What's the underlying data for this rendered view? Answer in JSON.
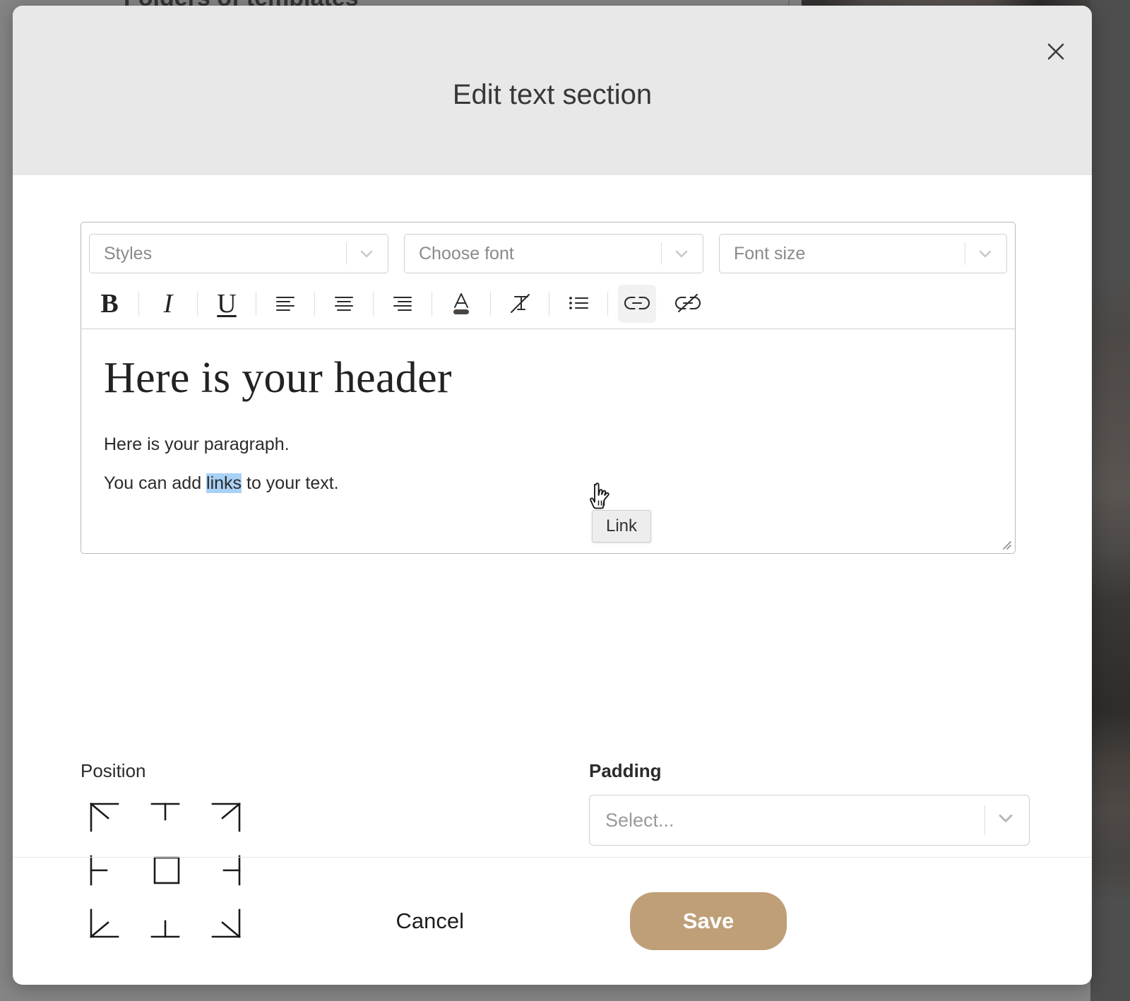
{
  "background": {
    "page_title": "Folders of templates"
  },
  "modal": {
    "title": "Edit text section",
    "close_icon": "close-icon"
  },
  "editor": {
    "selects": [
      {
        "name": "styles",
        "placeholder": "Styles"
      },
      {
        "name": "font",
        "placeholder": "Choose font"
      },
      {
        "name": "font-size",
        "placeholder": "Font size"
      }
    ],
    "toolbar_buttons": [
      {
        "name": "bold",
        "icon": "bold-icon",
        "label": "B",
        "active": false
      },
      {
        "name": "italic",
        "icon": "italic-icon",
        "label": "I",
        "active": false
      },
      {
        "name": "underline",
        "icon": "underline-icon",
        "label": "U",
        "active": false
      },
      {
        "name": "align-left",
        "icon": "align-left-icon",
        "label": "",
        "active": false
      },
      {
        "name": "align-center",
        "icon": "align-center-icon",
        "label": "",
        "active": false
      },
      {
        "name": "align-right",
        "icon": "align-right-icon",
        "label": "",
        "active": false
      },
      {
        "name": "text-color",
        "icon": "text-color-icon",
        "label": "",
        "active": false
      },
      {
        "name": "clear-format",
        "icon": "clear-formatting-icon",
        "label": "",
        "active": false
      },
      {
        "name": "bullet-list",
        "icon": "bullet-list-icon",
        "label": "",
        "active": false
      },
      {
        "name": "link",
        "icon": "link-icon",
        "label": "",
        "active": true
      },
      {
        "name": "unlink",
        "icon": "unlink-icon",
        "label": "",
        "active": false
      }
    ],
    "tooltip": "Link",
    "content": {
      "heading": "Here is your header",
      "paragraph": "Here is your paragraph.",
      "link_line_before": "You can add ",
      "link_line_selected": "links",
      "link_line_after": " to your text.",
      "selection_color": "#a8d1f7"
    }
  },
  "position": {
    "label": "Position",
    "options": [
      {
        "name": "top-left",
        "icon": "position-top-left-icon"
      },
      {
        "name": "top-center",
        "icon": "position-top-center-icon"
      },
      {
        "name": "top-right",
        "icon": "position-top-right-icon"
      },
      {
        "name": "middle-left",
        "icon": "position-middle-left-icon"
      },
      {
        "name": "middle-center",
        "icon": "position-middle-center-icon"
      },
      {
        "name": "middle-right",
        "icon": "position-middle-right-icon"
      },
      {
        "name": "bottom-left",
        "icon": "position-bottom-left-icon"
      },
      {
        "name": "bottom-center",
        "icon": "position-bottom-center-icon"
      },
      {
        "name": "bottom-right",
        "icon": "position-bottom-right-icon"
      }
    ]
  },
  "padding": {
    "label": "Padding",
    "placeholder": "Select..."
  },
  "footer": {
    "cancel_label": "Cancel",
    "save_label": "Save",
    "save_color": "#bf9f78"
  }
}
